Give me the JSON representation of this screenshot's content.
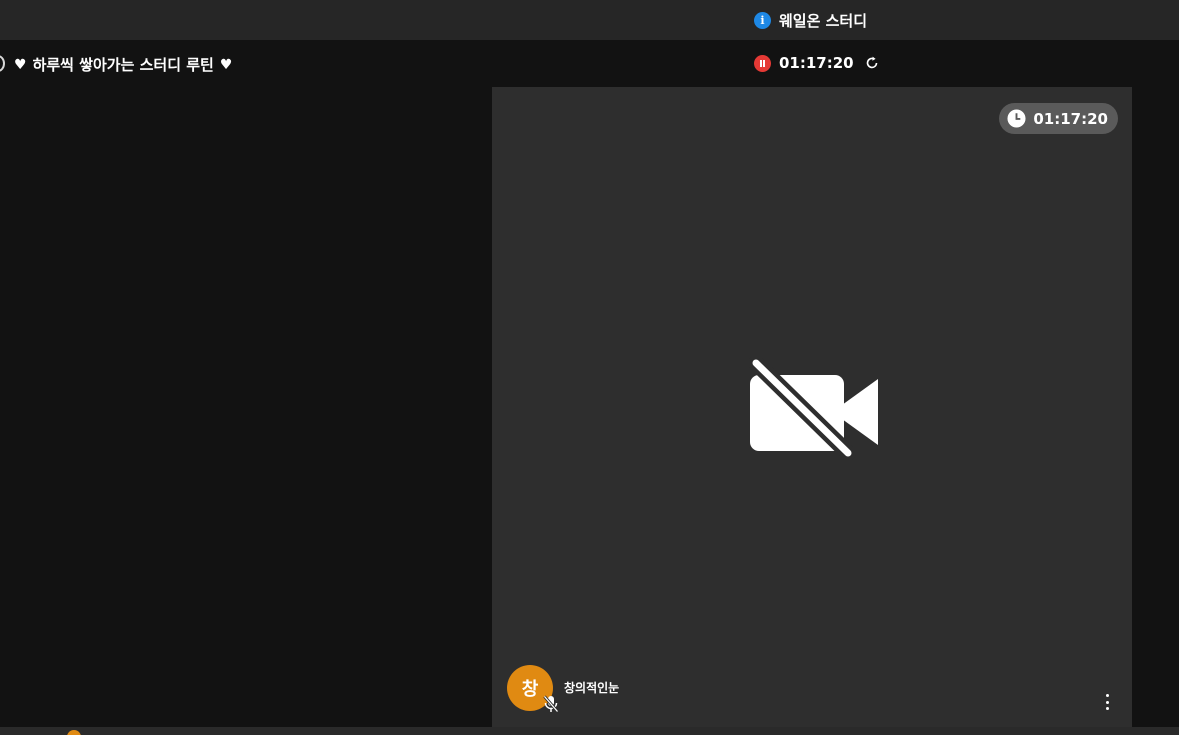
{
  "header": {
    "app_title": "웨일온 스터디",
    "info_icon": "info-icon",
    "info_glyph": "i"
  },
  "study": {
    "title": "하루씩 쌓아가는 스터디 루틴",
    "heart_icon": "heart-icon",
    "heart_glyph": "♥",
    "timer": "01:17:20",
    "pause_icon": "pause-icon",
    "refresh_icon": "refresh-icon"
  },
  "tile": {
    "timer": "01:17:20",
    "clock_icon": "clock-icon",
    "camera_state_icon": "video-camera-off-icon",
    "user": {
      "avatar_initial": "창",
      "name": "창의적인눈",
      "mic_icon": "mic-off-icon"
    },
    "more_icon": "more-vertical-icon"
  },
  "colors": {
    "info_blue": "#1e88e5",
    "record_red": "#e53935",
    "avatar_orange": "#e08a12",
    "tile_bg": "#2e2e2e",
    "app_bg": "#121212"
  }
}
